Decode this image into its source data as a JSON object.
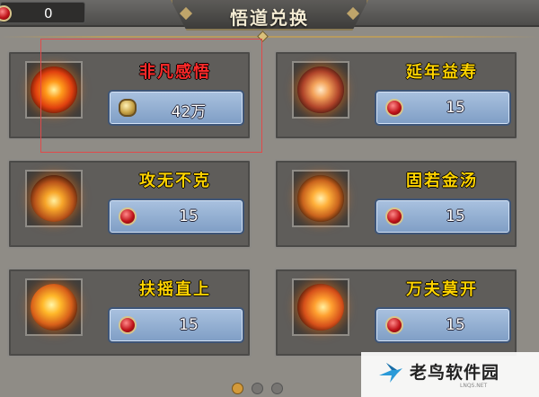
{
  "header": {
    "currency_value": "0",
    "title": "悟道兑换"
  },
  "cards": [
    {
      "name": "非凡感悟",
      "price": "42万",
      "price_icon": "coin-icon",
      "highlighted": true
    },
    {
      "name": "延年益寿",
      "price": "15",
      "price_icon": "red-gem-icon"
    },
    {
      "name": "攻无不克",
      "price": "15",
      "price_icon": "red-gem-icon"
    },
    {
      "name": "固若金汤",
      "price": "15",
      "price_icon": "red-gem-icon"
    },
    {
      "name": "扶摇直上",
      "price": "15",
      "price_icon": "red-gem-icon"
    },
    {
      "name": "万夫莫开",
      "price": "15",
      "price_icon": "red-gem-icon"
    }
  ],
  "pager": {
    "pages": 3,
    "current": 1
  },
  "watermark": {
    "text": "老鸟软件园",
    "sub": "LNQS.NET"
  },
  "colors": {
    "name_gold": "#ffd400",
    "name_red": "#ff2a2a",
    "price_box": "#8fabd1",
    "card_bg": "#5f5d5a"
  }
}
